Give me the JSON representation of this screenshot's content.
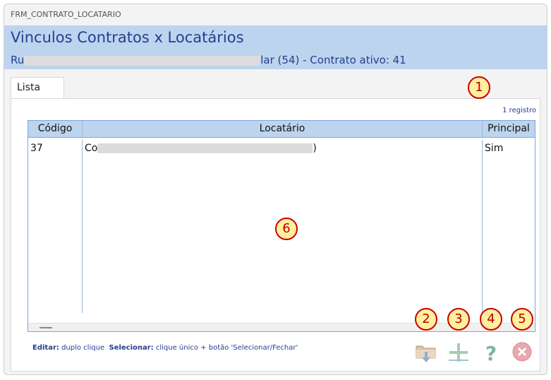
{
  "window": {
    "title": "FRM_CONTRATO_LOCATARIO",
    "header_title": "Vinculos Contratos x Locatários",
    "subtitle_start": "Ru",
    "subtitle_end": "lar (54) - Contrato ativo: 41"
  },
  "tabs": [
    {
      "label": "Lista"
    }
  ],
  "record_count": "1 registro",
  "grid": {
    "columns": [
      "Código",
      "Locatário",
      "Principal"
    ],
    "rows": [
      {
        "codigo": "37",
        "locatario_start": "Co",
        "locatario_end": ")",
        "principal": "Sim"
      }
    ]
  },
  "hint": {
    "edit_label": "Editar:",
    "edit_text": "duplo clique",
    "select_label": "Selecionar:",
    "select_text": "clique único + botão 'Selecionar/Fechar'"
  },
  "toolbar": {
    "icons": [
      "select-import-icon",
      "add-icon",
      "help-icon",
      "close-icon"
    ]
  },
  "annotations": [
    "1",
    "2",
    "3",
    "4",
    "5",
    "6"
  ],
  "colors": {
    "accent": "#243f8f",
    "header_bg": "#bdd4ee",
    "badge_fill": "#ffef9e",
    "badge_border": "#cc0000"
  }
}
